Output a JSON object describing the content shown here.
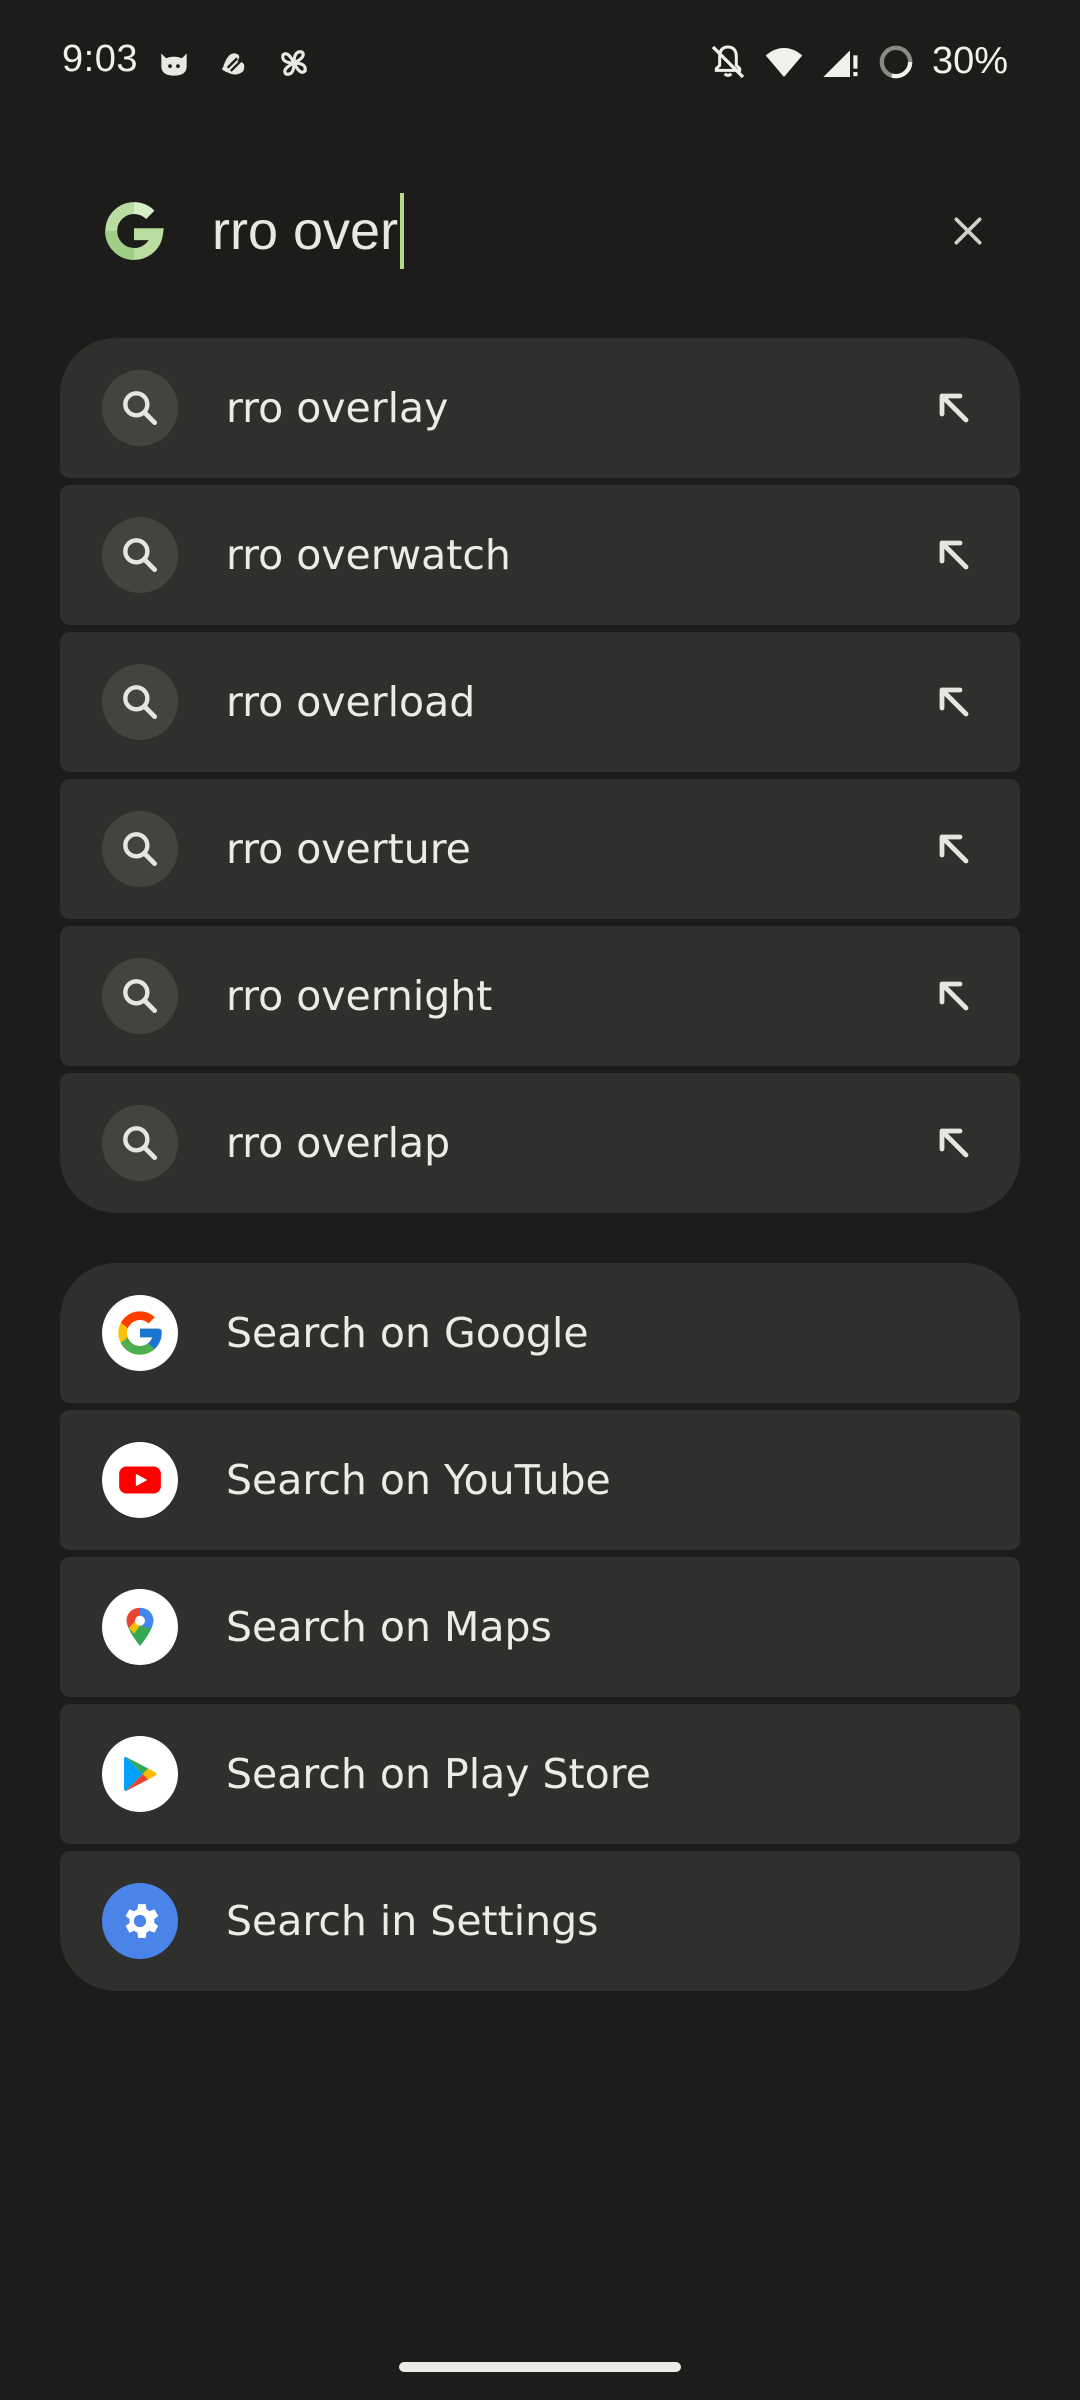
{
  "status_bar": {
    "time": "9:03",
    "battery": "30%",
    "left_icons": [
      "cat-app-icon",
      "fabric-app-icon",
      "pinwheel-app-icon"
    ],
    "right_icons": [
      "notifications-off-icon",
      "wifi-icon",
      "signal-icon",
      "battery-saver-icon"
    ]
  },
  "search": {
    "query": "rro over",
    "caret_color": "#b6d989"
  },
  "suggestions": [
    {
      "label": "rro overlay"
    },
    {
      "label": "rro overwatch"
    },
    {
      "label": "rro overload"
    },
    {
      "label": "rro overture"
    },
    {
      "label": "rro overnight"
    },
    {
      "label": "rro overlap"
    }
  ],
  "providers": [
    {
      "label": "Search on Google",
      "icon": "google-icon"
    },
    {
      "label": "Search on YouTube",
      "icon": "youtube-icon"
    },
    {
      "label": "Search on Maps",
      "icon": "maps-icon"
    },
    {
      "label": "Search on Play Store",
      "icon": "play-store-icon"
    },
    {
      "label": "Search in Settings",
      "icon": "settings-gear-icon"
    }
  ],
  "colors": {
    "background": "#1c1d1a",
    "row_background": "#2f302d",
    "icon_circle": "#434440"
  }
}
